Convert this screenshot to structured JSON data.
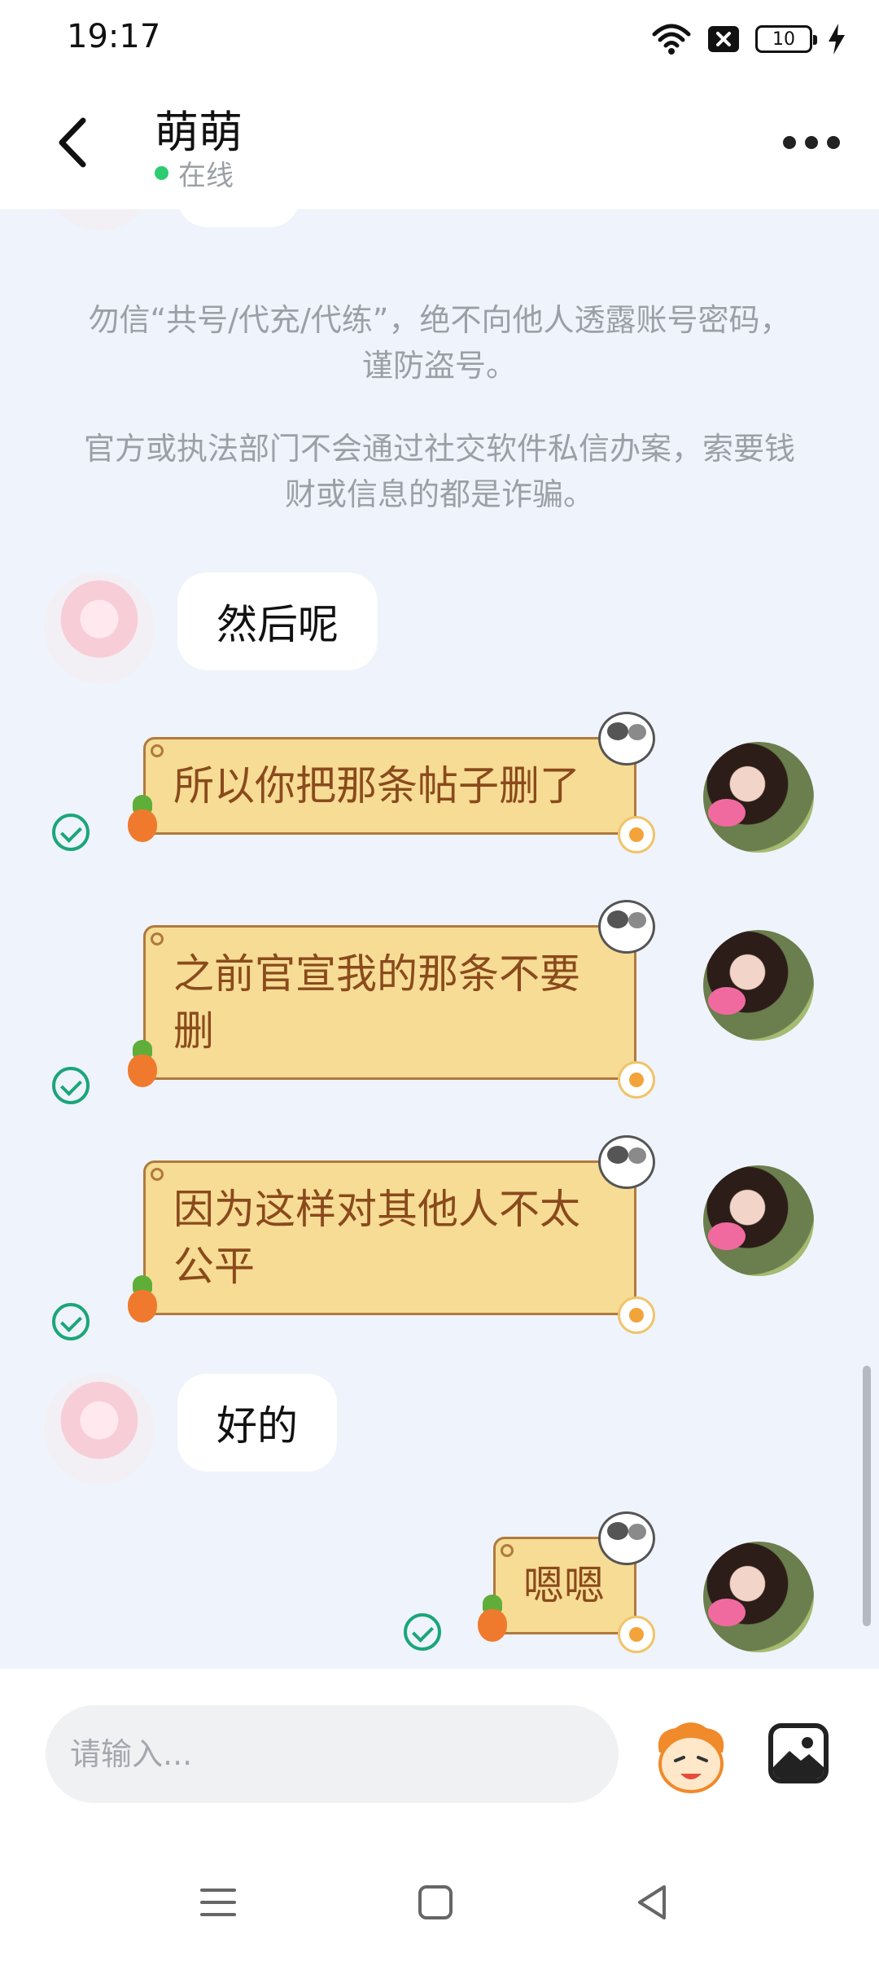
{
  "status_bar": {
    "time": "19:17",
    "battery": "10",
    "icons": [
      "wifi-icon",
      "sim-blocked-icon",
      "battery-icon",
      "charging-icon"
    ]
  },
  "header": {
    "title": "萌萌",
    "status": "在线",
    "status_color": "#2ecc71"
  },
  "notices": [
    "勿信“共号/代充/代练”，绝不向他人透露账号密码，谨防盗号。",
    "官方或执法部门不会通过社交软件私信办案，索要钱财或信息的都是诈骗。"
  ],
  "messages": [
    {
      "side": "left",
      "text": "然后呢"
    },
    {
      "side": "right",
      "text": "所以你把那条帖子删了",
      "sent": true
    },
    {
      "side": "right",
      "text": "之前官宣我的那条不要删",
      "sent": true
    },
    {
      "side": "right",
      "text": "因为这样对其他人不太公平",
      "sent": true
    },
    {
      "side": "left",
      "text": "好的"
    },
    {
      "side": "right",
      "text": "嗯嗯",
      "sent": true
    }
  ],
  "input": {
    "placeholder": "请输入..."
  },
  "colors": {
    "background": "#eff3fb",
    "bubble_out": "#f6dc95",
    "bubble_out_text": "#8a4a1c",
    "check": "#1aa67a"
  }
}
